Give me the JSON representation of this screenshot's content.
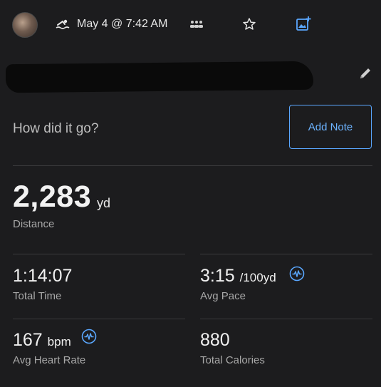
{
  "header": {
    "date_text": "May 4 @ 7:42 AM"
  },
  "prompt": {
    "question": "How did it go?",
    "add_note_label": "Add Note"
  },
  "distance": {
    "value": "2,283",
    "unit": "yd",
    "label": "Distance"
  },
  "stats": [
    {
      "value": "1:14:07",
      "unit": "",
      "label": "Total Time"
    },
    {
      "value": "3:15",
      "unit": "/100yd",
      "label": "Avg Pace"
    },
    {
      "value": "167",
      "unit": "bpm",
      "label": "Avg Heart Rate"
    },
    {
      "value": "880",
      "unit": "",
      "label": "Total Calories"
    }
  ],
  "colors": {
    "background": "#1c1c1e",
    "accent": "#5aa7ff",
    "divider": "#3a3a3c",
    "redaction": "#0a0a0a"
  },
  "icons": {
    "activity": "swim-icon",
    "group": "group-icon",
    "favorite": "star-icon",
    "media": "add-media-icon",
    "edit": "pencil-icon",
    "data_source": "pulse-icon"
  }
}
